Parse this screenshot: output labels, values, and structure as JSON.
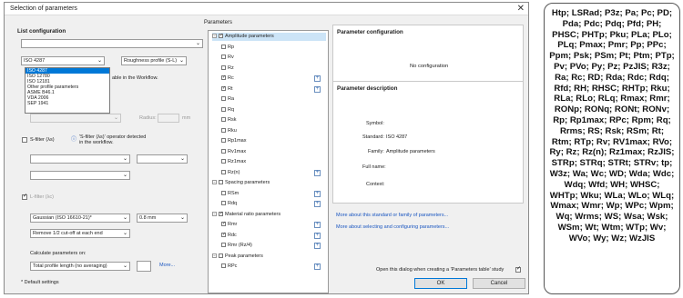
{
  "dialog": {
    "title": "Selection of parameters",
    "close_glyph": "✕"
  },
  "list_config": {
    "title": "List configuration",
    "search_value": "",
    "standard_select": "ISO 4287",
    "profile_select": "Roughness profile (S-L)",
    "standard_options": [
      "ISO 4287",
      "ISO 12780",
      "ISO 12181",
      "Other profile parameters",
      "ASME B46.1",
      "VDA 2006",
      "SEP 1941"
    ],
    "workflow_note": "able in the Workflow.",
    "radius_label": "Radius:",
    "radius_unit": "mm",
    "s_filter_label": "S-filter (λs)",
    "s_filter_note": "'S-filter (λs)' operator detected in the workflow.",
    "l_filter_label": "L-filter (λc)",
    "gaussian_select": "Gaussian (ISO 16610-21)*",
    "cutoff_select": "0.8 mm",
    "remove_select": "Remove 1/2 cut-off at each end",
    "calc_label": "Calculate parameters on:",
    "calc_select": "Total profile length (no averaging)",
    "more_label": "More...",
    "default_note": "* Default settings"
  },
  "parameters": {
    "title": "Parameters",
    "tree": [
      {
        "label": "Amplitude parameters",
        "group": true,
        "checked": true,
        "highlight": true
      },
      {
        "label": "Rp",
        "checked": false
      },
      {
        "label": "Rv",
        "checked": false
      },
      {
        "label": "Rz",
        "checked": false
      },
      {
        "label": "Rc",
        "checked": true,
        "plus": true
      },
      {
        "label": "Rt",
        "checked": true,
        "plus": true
      },
      {
        "label": "Ra",
        "checked": false
      },
      {
        "label": "Rq",
        "checked": false
      },
      {
        "label": "Rsk",
        "checked": false
      },
      {
        "label": "Rku",
        "checked": false
      },
      {
        "label": "Rp1max",
        "checked": false
      },
      {
        "label": "Rv1max",
        "checked": false
      },
      {
        "label": "Rz1max",
        "checked": false
      },
      {
        "label": "Rz(n)",
        "checked": false,
        "plus": true
      },
      {
        "label": "Spacing parameters",
        "group": true,
        "checked": false
      },
      {
        "label": "RSm",
        "checked": false,
        "plus": true
      },
      {
        "label": "Rdq",
        "checked": false,
        "plus": true
      },
      {
        "label": "Material ratio parameters",
        "group": true,
        "checked": true
      },
      {
        "label": "Rmr",
        "checked": true,
        "plus": true
      },
      {
        "label": "Rdc",
        "checked": true,
        "plus": true
      },
      {
        "label": "Rmr (Rz/4)",
        "checked": false,
        "plus": true
      },
      {
        "label": "Peak parameters",
        "group": true,
        "checked": false
      },
      {
        "label": "RPc",
        "checked": false,
        "plus": true
      }
    ]
  },
  "param_config": {
    "title": "Parameter configuration",
    "empty_text": "No configuration"
  },
  "param_desc": {
    "title": "Parameter description",
    "symbol_label": "Symbol:",
    "standard_label": "Standard:",
    "standard_value": "ISO 4287",
    "family_label": "Family:",
    "family_value": "Amplitude parameters",
    "fullname_label": "Full name:",
    "context_label": "Context:",
    "link1": "More about this standard or family of parameters...",
    "link2": "More about selecting and configuring parameters..."
  },
  "footer": {
    "open_dialog_label": "Open this dialog when creating a 'Parameters table' study",
    "ok_label": "OK",
    "cancel_label": "Cancel"
  },
  "side_list": {
    "text": "Htp; LSRad; P3z; Pa; Pc; PD; Pda; Pdc; Pdq; Pfd; PH; PHSC; PHTp; Pku; PLa; PLo; PLq; Pmax; Pmr; Pp; PPc; Ppm; Psk; PSm; Pt; Ptm; PTp; Pv; PVo; Py; Pz; PzJIS; R3z; Ra; Rc; RD; Rda; Rdc; Rdq; Rfd; RH; RHSC; RHTp; Rku; RLa; RLo; RLq; Rmax; Rmr; RONp; RONq; RONt; RONv; Rp; Rp1max; RPc; Rpm; Rq; Rrms; RS; Rsk; RSm; Rt; Rtm; RTp; Rv; RV1max; RVo; Ry; Rz; Rz(n); Rz1max; RzJIS; STRp; STRq; STRt; STRv; tp; W3z; Wa; Wc; WD; Wda; Wdc; Wdq; Wfd; WH; WHSC; WHTp; Wku; WLa; WLo; WLq; Wmax; Wmr; Wp; WPc; Wpm; Wq; Wrms; WS; Wsa; Wsk; WSm; Wt; Wtm; WTp; Wv; WVo; Wy; Wz; WzJIS"
  }
}
